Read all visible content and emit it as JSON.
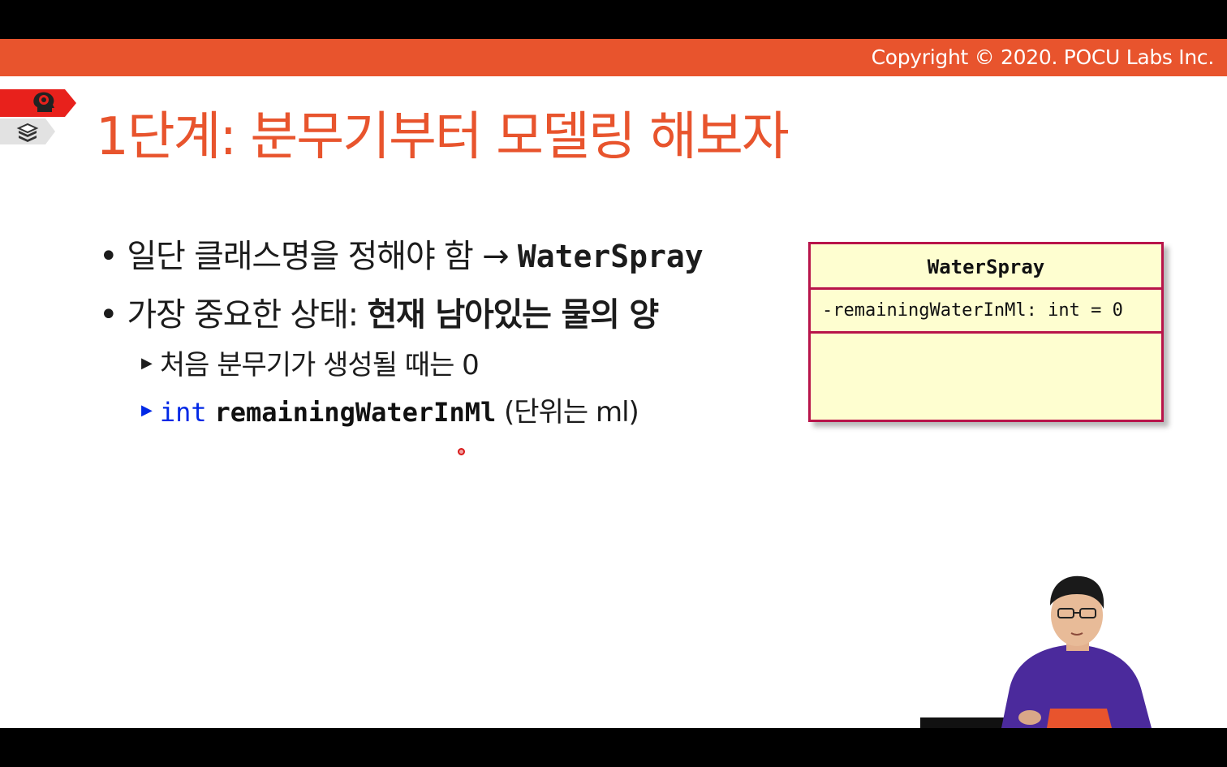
{
  "header": {
    "copyright": "Copyright © 2020. POCU Labs Inc."
  },
  "nav_tags": {
    "primary_icon": "brain-head-icon",
    "secondary_icon": "book-stack-icon"
  },
  "title": "1단계: 분무기부터 모델링 해보자",
  "bullets": [
    {
      "text": "일단 클래스명을 정해야 함 → ",
      "code": "WaterSpray"
    },
    {
      "text": "가장 중요한 상태: ",
      "bold": "현재 남아있는 물의 양"
    }
  ],
  "sub_bullets": [
    {
      "text": "처음 분무기가 생성될 때는 0"
    },
    {
      "keyword": "int",
      "identifier": "remainingWaterInMl",
      "suffix": "(단위는 ml)"
    }
  ],
  "uml": {
    "class_name": "WaterSpray",
    "attribute": "-remainingWaterInMl: int = 0"
  },
  "colors": {
    "accent": "#e8542d",
    "tag_red": "#e8211c",
    "uml_border": "#b8144a",
    "uml_fill": "#fefed0",
    "keyword_blue": "#0028e6"
  }
}
